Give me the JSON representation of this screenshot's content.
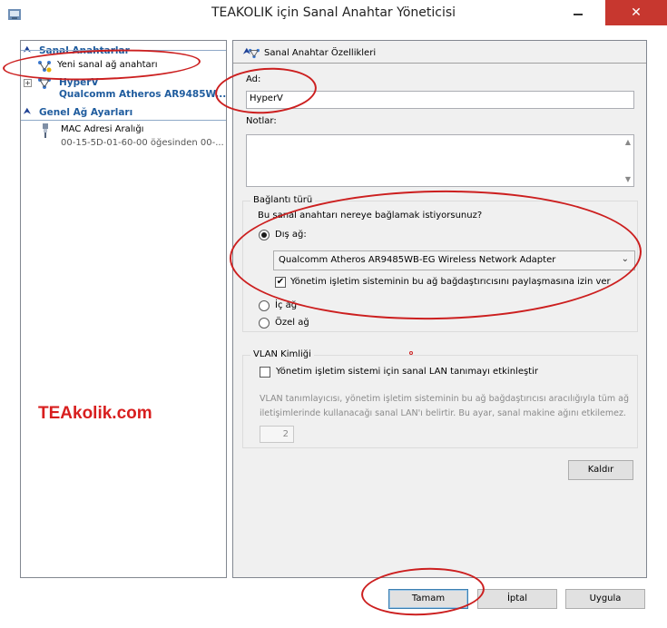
{
  "window": {
    "title": "TEAKOLIK için Sanal Anahtar Yöneticisi",
    "close_glyph": "✕"
  },
  "sidebar": {
    "sections": [
      {
        "label": "Sanal Anahtarlar"
      },
      {
        "label": "Genel Ağ Ayarları"
      }
    ],
    "new_switch": "Yeni sanal ağ anahtarı",
    "switch_name": "HyperV",
    "switch_adapter": "Qualcomm Atheros AR9485W...",
    "mac_title": "MAC Adresi Aralığı",
    "mac_value": "00-15-5D-01-60-00 öğesinden 00-...",
    "watermark": "TEAkolik.com"
  },
  "properties": {
    "header": "Sanal Anahtar Özellikleri",
    "name_label": "Ad:",
    "name_value": "HyperV",
    "notes_label": "Notlar:",
    "notes_value": "",
    "connection": {
      "title": "Bağlantı türü",
      "question": "Bu sanal anahtarı nereye bağlamak istiyorsunuz?",
      "external": "Dış ağ:",
      "adapter_selected": "Qualcomm Atheros AR9485WB-EG Wireless Network Adapter",
      "share_label": "Yönetim işletim sisteminin bu ağ bağdaştırıcısını paylaşmasına izin ver",
      "share_checked": true,
      "internal": "İç ağ",
      "private": "Özel ağ",
      "selected": "external"
    },
    "vlan": {
      "title": "VLAN Kimliği",
      "enable_label": "Yönetim işletim sistemi için sanal LAN tanımayı etkinleştir",
      "enable_checked": false,
      "description_line1": "VLAN tanımlayıcısı, yönetim işletim sisteminin bu ağ bağdaştırıcısı aracılığıyla tüm ağ",
      "description_line2": "iletişimlerinde kullanacağı sanal LAN'ı belirtir. Bu ayar, sanal makine ağını etkilemez.",
      "value": "2"
    },
    "remove_button": "Kaldır"
  },
  "footer": {
    "ok": "Tamam",
    "cancel": "İptal",
    "apply": "Uygula"
  },
  "colors": {
    "accent": "#1f5c9e",
    "annotation": "#cc1f1f",
    "close": "#c7372f"
  }
}
